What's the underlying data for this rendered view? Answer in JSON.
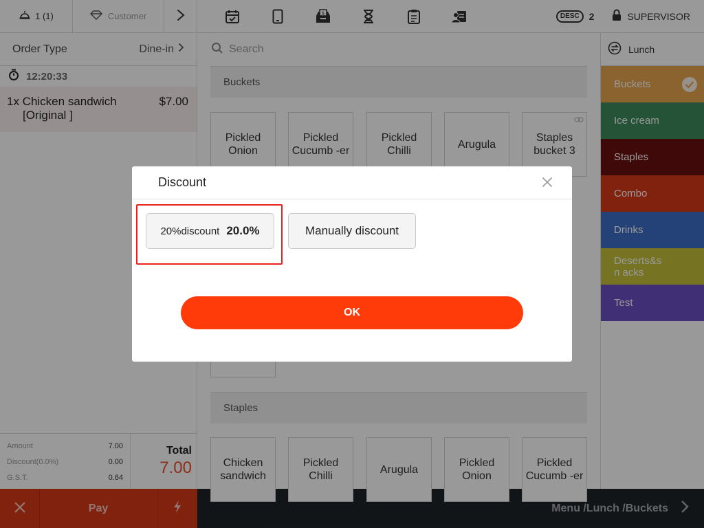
{
  "topbar": {
    "table_label": "1 (1)",
    "customer_label": "Customer",
    "desc_badge": "DESC",
    "desc_count": "2",
    "role": "SUPERVISOR",
    "icons": [
      "calendar-check-icon",
      "tablet-icon",
      "cash-drawer-icon",
      "hourglass-icon",
      "clipboard-icon",
      "user-card-icon"
    ]
  },
  "order": {
    "type_label": "Order Type",
    "type_value": "Dine-in",
    "timer": "12:20:33",
    "line": {
      "qty_name": "1x Chicken sandwich",
      "modifier": "[Original ]",
      "price": "$7.00"
    }
  },
  "summary": {
    "amount_label": "Amount",
    "amount_value": "7.00",
    "discount_label": "Discount(0.0%)",
    "discount_value": "0.00",
    "gst_label": "G.S.T.",
    "gst_value": "0.64",
    "total_label": "Total",
    "total_value": "7.00"
  },
  "actions": {
    "pay_label": "Pay"
  },
  "breadcrumb": "Menu /Lunch /Buckets",
  "search": {
    "placeholder": "Search"
  },
  "sections": {
    "buckets": {
      "title": "Buckets",
      "items": [
        "Pickled Onion",
        "Pickled Cucumb -er",
        "Pickled Chilli",
        "Arugula",
        "Staples bucket 3"
      ]
    },
    "staples": {
      "title": "Staples",
      "items": [
        "Chicken sandwich",
        "Pickled Chilli",
        "Arugula",
        "Pickled Onion",
        "Pickled Cucumb -er"
      ]
    }
  },
  "categories": {
    "menu_label": "Lunch",
    "items": [
      {
        "label": "Buckets",
        "color": "#e8a64f",
        "selected": true
      },
      {
        "label": "Ice cream",
        "color": "#3f8a5e"
      },
      {
        "label": "Staples",
        "color": "#6b1010"
      },
      {
        "label": "Combo",
        "color": "#d83a1a"
      },
      {
        "label": "Drinks",
        "color": "#3e6fc9"
      },
      {
        "label": "Deserts&sn acks",
        "color": "#c5c13a"
      },
      {
        "label": "Test",
        "color": "#6d4fc4"
      }
    ]
  },
  "modal": {
    "title": "Discount",
    "discount_option": {
      "name": "20%discount",
      "value": "20.0%"
    },
    "manual_label": "Manually discount",
    "ok_label": "OK"
  }
}
